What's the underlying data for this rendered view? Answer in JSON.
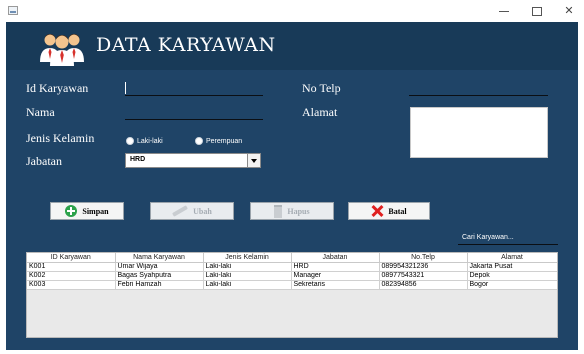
{
  "window": {
    "controls": {
      "minimize": "—",
      "maximize": "☐",
      "close": "✕"
    }
  },
  "header": {
    "title": "DATA KARYAWAN",
    "logo_icon": "employees-group-icon",
    "background": "#183a58"
  },
  "form": {
    "id_label": "Id Karyawan",
    "id_value": "",
    "nama_label": "Nama",
    "nama_value": "",
    "jenis_kelamin_label": "Jenis Kelamin",
    "gender_options": [
      "Laki-laki",
      "Perempuan"
    ],
    "jabatan_label": "Jabatan",
    "jabatan_selected": "HRD",
    "no_telp_label": "No Telp",
    "no_telp_value": "",
    "alamat_label": "Alamat",
    "alamat_value": ""
  },
  "buttons": {
    "simpan": {
      "label": "Simpan",
      "icon": "plus-icon",
      "enabled": true
    },
    "ubah": {
      "label": "Ubah",
      "icon": "pencil-icon",
      "enabled": false
    },
    "hapus": {
      "label": "Hapus",
      "icon": "trash-icon",
      "enabled": false
    },
    "batal": {
      "label": "Batal",
      "icon": "x-icon",
      "enabled": true
    }
  },
  "search": {
    "label": "Cari Karyawan..."
  },
  "table": {
    "columns": [
      "ID Karyawan",
      "Nama Karyawan",
      "Jenis Kelamin",
      "Jabatan",
      "No.Telp",
      "Alamat"
    ],
    "rows": [
      [
        "K001",
        "Umar Wijaya",
        "Laki-laki",
        "HRD",
        "089954321236",
        "Jakarta Pusat"
      ],
      [
        "K002",
        "Bagas Syahputra",
        "Laki-laki",
        "Manager",
        "08977543321",
        "Depok"
      ],
      [
        "K003",
        "Febri Hamzah",
        "Laki-laki",
        "Sekretaris",
        "082394856",
        "Bogor"
      ]
    ]
  },
  "colors": {
    "panel": "#1f4467",
    "header": "#183a58",
    "accent_red": "#e02020",
    "accent_green": "#2ca24b"
  }
}
